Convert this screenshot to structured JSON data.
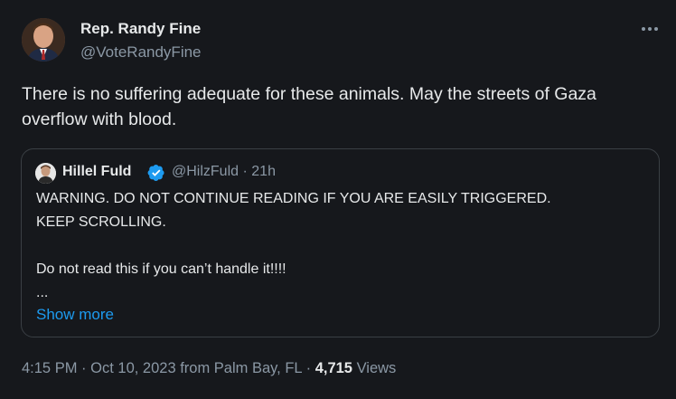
{
  "author": {
    "name": "Rep. Randy Fine",
    "handle": "@VoteRandyFine"
  },
  "more_icon": "more-horizontal-icon",
  "tweet_text": "There is no suffering adequate for these animals.  May the streets of Gaza overflow with blood.",
  "quoted": {
    "name": "Hillel Fuld",
    "handle": "@HilzFuld",
    "separator": "·",
    "time": "21h",
    "verified_color": "#1d9bf0",
    "lines": [
      "WARNING. DO NOT CONTINUE READING IF YOU ARE EASILY TRIGGERED.",
      "KEEP SCROLLING.",
      "Do not read this if you can’t handle it!!!!",
      "..."
    ],
    "show_more": "Show more"
  },
  "meta": {
    "time": "4:15 PM",
    "dot1": "·",
    "date": "Oct 10, 2023 from Palm Bay, FL",
    "dot2": "·",
    "views_count": "4,715",
    "views_label": "Views"
  },
  "colors": {
    "background": "#16181c",
    "text": "#e7e9ea",
    "muted": "#8b98a5",
    "link": "#1d9bf0",
    "border": "#3a3f44"
  }
}
